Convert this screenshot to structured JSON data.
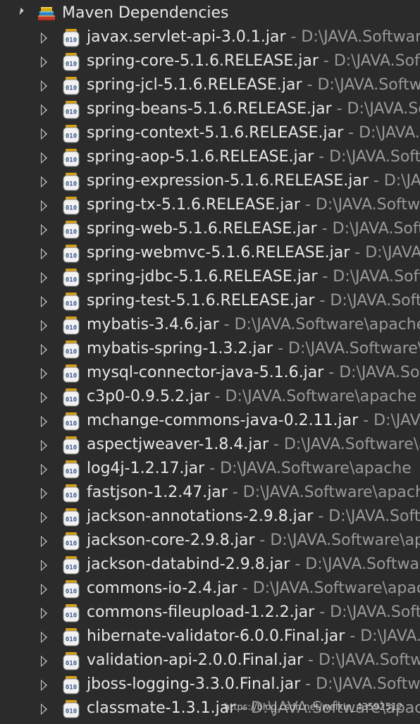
{
  "tree": {
    "root_label": "Maven Dependencies",
    "items": [
      {
        "name": "javax.servlet-api-3.0.1.jar",
        "path": " - D:\\JAVA.Software\\apache"
      },
      {
        "name": "spring-core-5.1.6.RELEASE.jar",
        "path": " - D:\\JAVA.Software\\apache"
      },
      {
        "name": "spring-jcl-5.1.6.RELEASE.jar",
        "path": " - D:\\JAVA.Software\\apache"
      },
      {
        "name": "spring-beans-5.1.6.RELEASE.jar",
        "path": " - D:\\JAVA.Software\\apache"
      },
      {
        "name": "spring-context-5.1.6.RELEASE.jar",
        "path": " - D:\\JAVA.Software\\apache"
      },
      {
        "name": "spring-aop-5.1.6.RELEASE.jar",
        "path": " - D:\\JAVA.Software\\apache"
      },
      {
        "name": "spring-expression-5.1.6.RELEASE.jar",
        "path": " - D:\\JAVA.Software\\apache"
      },
      {
        "name": "spring-tx-5.1.6.RELEASE.jar",
        "path": " - D:\\JAVA.Software\\apache"
      },
      {
        "name": "spring-web-5.1.6.RELEASE.jar",
        "path": " - D:\\JAVA.Software\\apache"
      },
      {
        "name": "spring-webmvc-5.1.6.RELEASE.jar",
        "path": " - D:\\JAVA.Software\\apache"
      },
      {
        "name": "spring-jdbc-5.1.6.RELEASE.jar",
        "path": " - D:\\JAVA.Software\\apache"
      },
      {
        "name": "spring-test-5.1.6.RELEASE.jar",
        "path": " - D:\\JAVA.Software\\apache"
      },
      {
        "name": "mybatis-3.4.6.jar",
        "path": " - D:\\JAVA.Software\\apache"
      },
      {
        "name": "mybatis-spring-1.3.2.jar",
        "path": " - D:\\JAVA.Software\\apache"
      },
      {
        "name": "mysql-connector-java-5.1.6.jar",
        "path": " - D:\\JAVA.Software\\apache"
      },
      {
        "name": "c3p0-0.9.5.2.jar",
        "path": " - D:\\JAVA.Software\\apache"
      },
      {
        "name": "mchange-commons-java-0.2.11.jar",
        "path": " - D:\\JAVA.Software\\apache"
      },
      {
        "name": "aspectjweaver-1.8.4.jar",
        "path": " - D:\\JAVA.Software\\apache"
      },
      {
        "name": "log4j-1.2.17.jar",
        "path": " - D:\\JAVA.Software\\apache"
      },
      {
        "name": "fastjson-1.2.47.jar",
        "path": " - D:\\JAVA.Software\\apache"
      },
      {
        "name": "jackson-annotations-2.9.8.jar",
        "path": " - D:\\JAVA.Software\\apache"
      },
      {
        "name": "jackson-core-2.9.8.jar",
        "path": " - D:\\JAVA.Software\\apache"
      },
      {
        "name": "jackson-databind-2.9.8.jar",
        "path": " - D:\\JAVA.Software\\apache"
      },
      {
        "name": "commons-io-2.4.jar",
        "path": " - D:\\JAVA.Software\\apache"
      },
      {
        "name": "commons-fileupload-1.2.2.jar",
        "path": " - D:\\JAVA.Software\\apache"
      },
      {
        "name": "hibernate-validator-6.0.0.Final.jar",
        "path": " - D:\\JAVA.Software\\apache"
      },
      {
        "name": "validation-api-2.0.0.Final.jar",
        "path": " - D:\\JAVA.Software\\apache"
      },
      {
        "name": "jboss-logging-3.3.0.Final.jar",
        "path": " - D:\\JAVA.Software\\apache"
      },
      {
        "name": "classmate-1.3.1.jar",
        "path": " - D:\\JAVA.Software\\apache"
      }
    ]
  },
  "icons": {
    "root": "books-icon",
    "item": "jar-icon",
    "item_text": "010"
  },
  "watermark": "https://blog.csdn.net/weixin_43592512",
  "colors": {
    "background": "#2b2b2b",
    "name_text": "#e8e8e8",
    "path_text": "#9a9a9a"
  }
}
